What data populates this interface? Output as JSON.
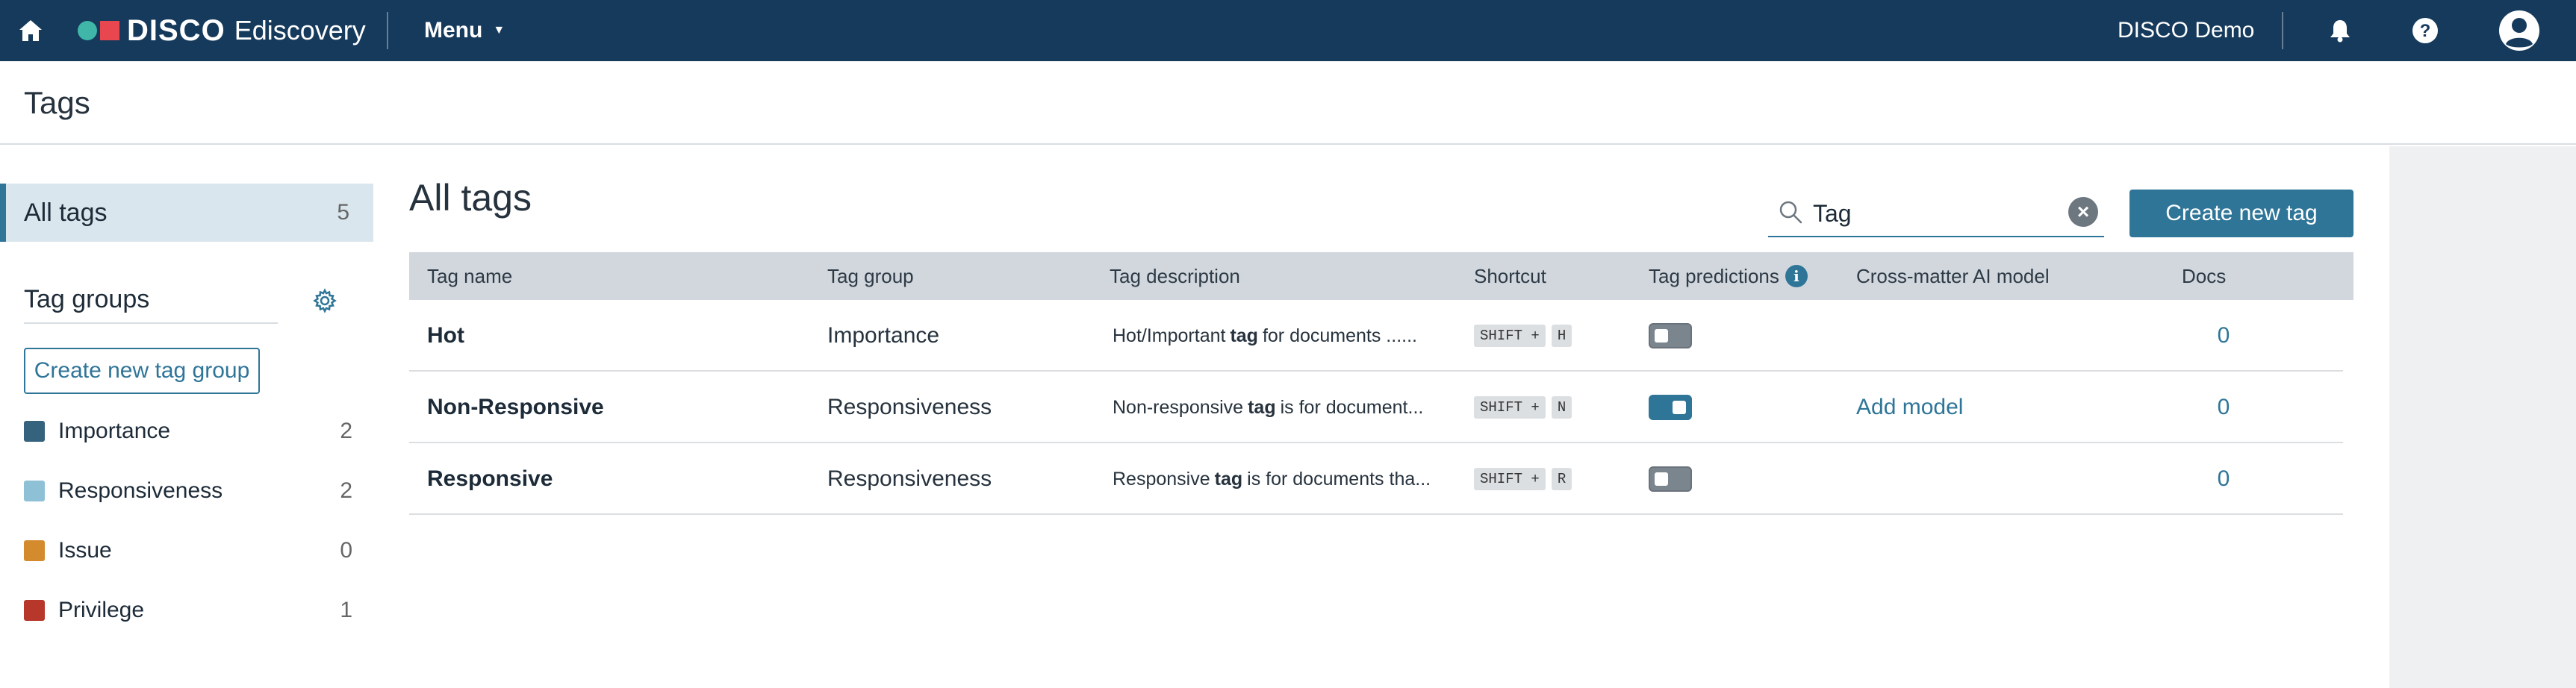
{
  "topbar": {
    "brand": "DISCO",
    "product": "Ediscovery",
    "menu_label": "Menu",
    "account_name": "DISCO Demo",
    "icons": [
      "home-icon",
      "bell-icon",
      "help-icon",
      "user-avatar-icon"
    ]
  },
  "page": {
    "title": "Tags"
  },
  "sidebar": {
    "all_tags": {
      "label": "All tags",
      "count": "5"
    },
    "groups_title": "Tag groups",
    "create_group_label": "Create new tag group",
    "groups": [
      {
        "name": "Importance",
        "count": "2",
        "color": "#35627d"
      },
      {
        "name": "Responsiveness",
        "count": "2",
        "color": "#8fc1d6"
      },
      {
        "name": "Issue",
        "count": "0",
        "color": "#d38b2e"
      },
      {
        "name": "Privilege",
        "count": "1",
        "color": "#b8372b"
      }
    ]
  },
  "main": {
    "heading": "All tags",
    "search": {
      "value": "Tag",
      "placeholder": ""
    },
    "create_tag_label": "Create new tag",
    "columns": [
      "Tag name",
      "Tag group",
      "Tag description",
      "Shortcut",
      "Tag predictions",
      "Cross-matter AI model",
      "Docs"
    ],
    "rows": [
      {
        "name": "Hot",
        "group": "Importance",
        "desc_pre": "Hot/Important",
        "desc_bold": "tag",
        "desc_post": "for documents ......",
        "mod": "SHIFT +",
        "key": "H",
        "prediction_on": false,
        "ai_model": "",
        "docs": "0"
      },
      {
        "name": "Non-Responsive",
        "group": "Responsiveness",
        "desc_pre": "Non-responsive",
        "desc_bold": "tag",
        "desc_post": "is for document...",
        "mod": "SHIFT +",
        "key": "N",
        "prediction_on": true,
        "ai_model": "Add model",
        "docs": "0"
      },
      {
        "name": "Responsive",
        "group": "Responsiveness",
        "desc_pre": "Responsive",
        "desc_bold": "tag",
        "desc_post": "is for documents tha...",
        "mod": "SHIFT +",
        "key": "R",
        "prediction_on": false,
        "ai_model": "",
        "docs": "0"
      }
    ]
  },
  "colors": {
    "topbar": "#163a5c",
    "accent": "#2f7598"
  }
}
